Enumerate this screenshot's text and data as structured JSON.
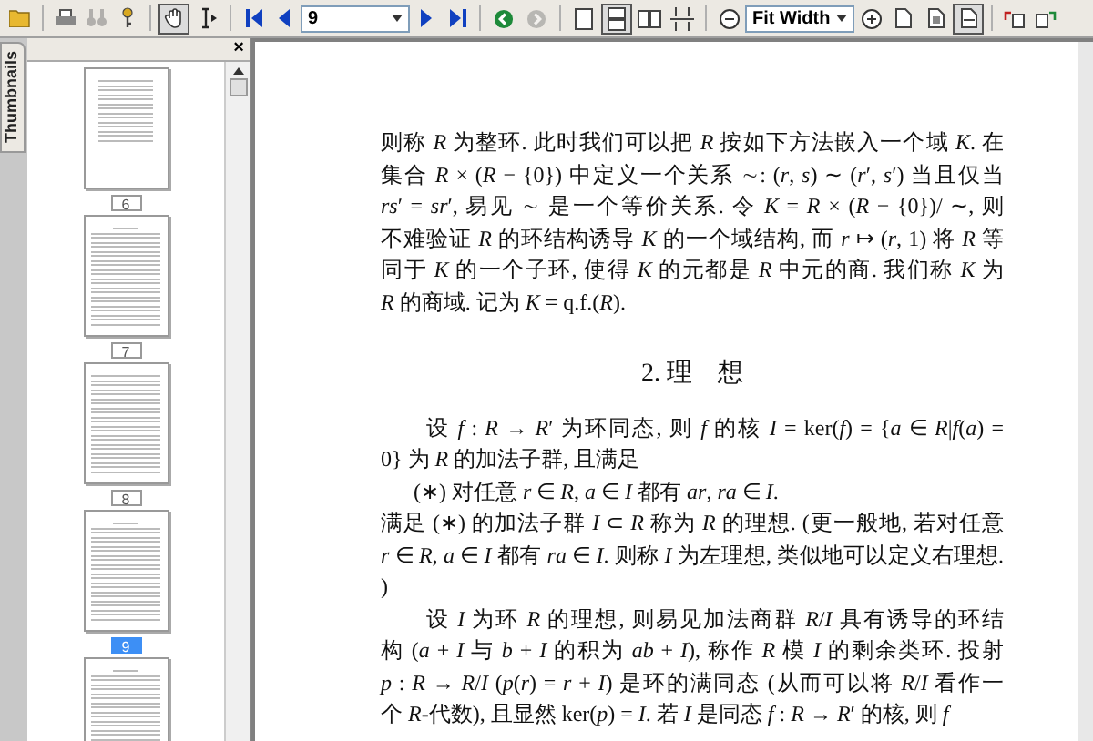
{
  "toolbar": {
    "page": "9",
    "zoom": "Fit Width",
    "tools": [
      {
        "kind": "hand",
        "selected": true
      },
      {
        "kind": "select",
        "selected": false
      }
    ],
    "history": [
      {
        "kind": "back",
        "disabled": false
      },
      {
        "kind": "forward",
        "disabled": true
      }
    ],
    "layouts": [
      {
        "kind": "single",
        "selected": false
      },
      {
        "kind": "continuous",
        "selected": true
      },
      {
        "kind": "facing",
        "selected": false
      },
      {
        "kind": "continuous-facing",
        "selected": false
      }
    ],
    "fits": [
      {
        "kind": "actual",
        "selected": false
      },
      {
        "kind": "fit-page",
        "selected": false
      },
      {
        "kind": "fit-width",
        "selected": true
      }
    ]
  },
  "sidebar": {
    "tab": "Thumbnails",
    "close": "×",
    "pages": [
      {
        "label": "6",
        "selected": false,
        "kind": "toc"
      },
      {
        "label": "7",
        "selected": false,
        "kind": "chapter"
      },
      {
        "label": "8",
        "selected": false,
        "kind": "text"
      },
      {
        "label": "9",
        "selected": true,
        "kind": "section"
      },
      {
        "kind": "chapter"
      }
    ]
  },
  "document": {
    "blocks": [
      {
        "kind": "continuation",
        "lines": [
          "则称 *R* 为整环. 此时我们可以把 *R* 按如下方法嵌入一个域 *K*. 在",
          "集合 *R* × (*R* − {0}) 中定义一个关系 ∼: (*r*, *s*) ∼ (*r*′, *s*′) 当且仅当",
          "*rs*′ = *sr*′, 易见 ∼ 是一个等价关系. 令 *K* = *R* × (*R* − {0})/ ∼, 则",
          "不难验证 *R* 的环结构诱导 *K* 的一个域结构, 而 *r* ↦ (*r*, 1) 将 *R* 等",
          "同于 *K* 的一个子环, 使得 *K* 的元都是 *R* 中元的商. 我们称 *K* 为",
          "*R* 的商域. 记为 *K* = q.f.(*R*)."
        ]
      },
      {
        "kind": "heading",
        "lines": [
          "2. 理　想"
        ]
      },
      {
        "kind": "paragraph",
        "lines": [
          "设 *f* : *R* → *R*′ 为环同态, 则 *f* 的核 *I* = ker(*f*) = {*a* ∈ *R*|*f*(*a*) =",
          "0} 为 *R* 的加法子群, 且满足"
        ]
      },
      {
        "kind": "condition",
        "lines": [
          "(∗) 对任意 *r* ∈ *R*, *a* ∈ *I* 都有 *ar*, *ra* ∈ *I*."
        ]
      },
      {
        "kind": "continuation",
        "lines": [
          "满足 (∗) 的加法子群 *I* ⊂ *R* 称为 *R* 的理想. (更一般地, 若对任意",
          "*r* ∈ *R*, *a* ∈ *I* 都有 *ra* ∈ *I*. 则称 *I* 为左理想, 类似地可以定义右理想.",
          ")"
        ]
      },
      {
        "kind": "paragraph",
        "lines": [
          "设 *I* 为环 *R* 的理想, 则易见加法商群 *R*/*I* 具有诱导的环结",
          "构 (*a* + *I* 与 *b* + *I* 的积为 *ab* + *I*), 称作 *R* 模 *I* 的剩余类环. 投射",
          "*p* : *R* → *R*/*I* (*p*(*r*) = *r* + *I*) 是环的满同态 (从而可以将 *R*/*I* 看作一",
          "个 *R*-代数), 且显然 ker(*p*) = *I*. 若 *I* 是同态 *f* : *R* → *R*′ 的核, 则 *f*"
        ]
      }
    ]
  }
}
